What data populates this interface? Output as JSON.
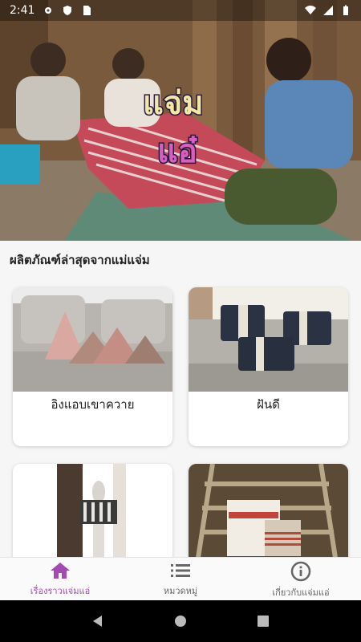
{
  "status_bar": {
    "time": "2:41"
  },
  "hero": {
    "logo_text_top": "แจ่ม",
    "logo_text_bottom": "แอ๋"
  },
  "section": {
    "title": "ผลิตภัณฑ์ล่าสุดจากแม่แจ่ม"
  },
  "products": [
    {
      "name": "อิงแอบเขาควาย"
    },
    {
      "name": "ฝันดี"
    },
    {
      "name": ""
    },
    {
      "name": ""
    }
  ],
  "bottom_nav": {
    "items": [
      {
        "label": "เรื่องราวแจ่มแอ่",
        "icon": "home-icon",
        "active": true
      },
      {
        "label": "หมวดหมู่",
        "icon": "list-icon",
        "active": false
      },
      {
        "label": "เกี่ยวกับแจ่มแอ่",
        "icon": "info-icon",
        "active": false
      }
    ]
  },
  "colors": {
    "accent": "#a24ab2",
    "inactive": "#666666"
  }
}
